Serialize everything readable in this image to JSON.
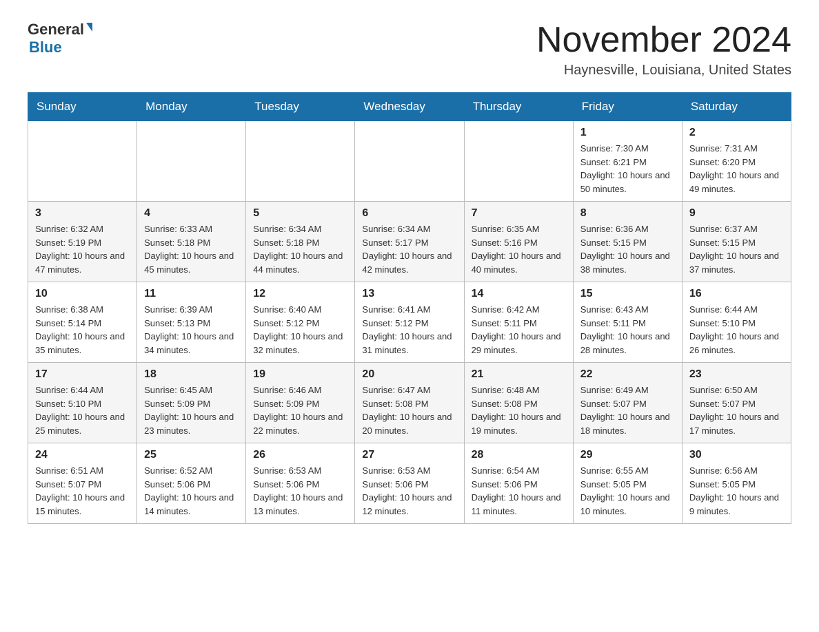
{
  "header": {
    "logo_general": "General",
    "logo_blue": "Blue",
    "title": "November 2024",
    "location": "Haynesville, Louisiana, United States"
  },
  "weekdays": [
    "Sunday",
    "Monday",
    "Tuesday",
    "Wednesday",
    "Thursday",
    "Friday",
    "Saturday"
  ],
  "rows": [
    {
      "cells": [
        {
          "day": "",
          "info": ""
        },
        {
          "day": "",
          "info": ""
        },
        {
          "day": "",
          "info": ""
        },
        {
          "day": "",
          "info": ""
        },
        {
          "day": "",
          "info": ""
        },
        {
          "day": "1",
          "info": "Sunrise: 7:30 AM\nSunset: 6:21 PM\nDaylight: 10 hours and 50 minutes."
        },
        {
          "day": "2",
          "info": "Sunrise: 7:31 AM\nSunset: 6:20 PM\nDaylight: 10 hours and 49 minutes."
        }
      ]
    },
    {
      "cells": [
        {
          "day": "3",
          "info": "Sunrise: 6:32 AM\nSunset: 5:19 PM\nDaylight: 10 hours and 47 minutes."
        },
        {
          "day": "4",
          "info": "Sunrise: 6:33 AM\nSunset: 5:18 PM\nDaylight: 10 hours and 45 minutes."
        },
        {
          "day": "5",
          "info": "Sunrise: 6:34 AM\nSunset: 5:18 PM\nDaylight: 10 hours and 44 minutes."
        },
        {
          "day": "6",
          "info": "Sunrise: 6:34 AM\nSunset: 5:17 PM\nDaylight: 10 hours and 42 minutes."
        },
        {
          "day": "7",
          "info": "Sunrise: 6:35 AM\nSunset: 5:16 PM\nDaylight: 10 hours and 40 minutes."
        },
        {
          "day": "8",
          "info": "Sunrise: 6:36 AM\nSunset: 5:15 PM\nDaylight: 10 hours and 38 minutes."
        },
        {
          "day": "9",
          "info": "Sunrise: 6:37 AM\nSunset: 5:15 PM\nDaylight: 10 hours and 37 minutes."
        }
      ]
    },
    {
      "cells": [
        {
          "day": "10",
          "info": "Sunrise: 6:38 AM\nSunset: 5:14 PM\nDaylight: 10 hours and 35 minutes."
        },
        {
          "day": "11",
          "info": "Sunrise: 6:39 AM\nSunset: 5:13 PM\nDaylight: 10 hours and 34 minutes."
        },
        {
          "day": "12",
          "info": "Sunrise: 6:40 AM\nSunset: 5:12 PM\nDaylight: 10 hours and 32 minutes."
        },
        {
          "day": "13",
          "info": "Sunrise: 6:41 AM\nSunset: 5:12 PM\nDaylight: 10 hours and 31 minutes."
        },
        {
          "day": "14",
          "info": "Sunrise: 6:42 AM\nSunset: 5:11 PM\nDaylight: 10 hours and 29 minutes."
        },
        {
          "day": "15",
          "info": "Sunrise: 6:43 AM\nSunset: 5:11 PM\nDaylight: 10 hours and 28 minutes."
        },
        {
          "day": "16",
          "info": "Sunrise: 6:44 AM\nSunset: 5:10 PM\nDaylight: 10 hours and 26 minutes."
        }
      ]
    },
    {
      "cells": [
        {
          "day": "17",
          "info": "Sunrise: 6:44 AM\nSunset: 5:10 PM\nDaylight: 10 hours and 25 minutes."
        },
        {
          "day": "18",
          "info": "Sunrise: 6:45 AM\nSunset: 5:09 PM\nDaylight: 10 hours and 23 minutes."
        },
        {
          "day": "19",
          "info": "Sunrise: 6:46 AM\nSunset: 5:09 PM\nDaylight: 10 hours and 22 minutes."
        },
        {
          "day": "20",
          "info": "Sunrise: 6:47 AM\nSunset: 5:08 PM\nDaylight: 10 hours and 20 minutes."
        },
        {
          "day": "21",
          "info": "Sunrise: 6:48 AM\nSunset: 5:08 PM\nDaylight: 10 hours and 19 minutes."
        },
        {
          "day": "22",
          "info": "Sunrise: 6:49 AM\nSunset: 5:07 PM\nDaylight: 10 hours and 18 minutes."
        },
        {
          "day": "23",
          "info": "Sunrise: 6:50 AM\nSunset: 5:07 PM\nDaylight: 10 hours and 17 minutes."
        }
      ]
    },
    {
      "cells": [
        {
          "day": "24",
          "info": "Sunrise: 6:51 AM\nSunset: 5:07 PM\nDaylight: 10 hours and 15 minutes."
        },
        {
          "day": "25",
          "info": "Sunrise: 6:52 AM\nSunset: 5:06 PM\nDaylight: 10 hours and 14 minutes."
        },
        {
          "day": "26",
          "info": "Sunrise: 6:53 AM\nSunset: 5:06 PM\nDaylight: 10 hours and 13 minutes."
        },
        {
          "day": "27",
          "info": "Sunrise: 6:53 AM\nSunset: 5:06 PM\nDaylight: 10 hours and 12 minutes."
        },
        {
          "day": "28",
          "info": "Sunrise: 6:54 AM\nSunset: 5:06 PM\nDaylight: 10 hours and 11 minutes."
        },
        {
          "day": "29",
          "info": "Sunrise: 6:55 AM\nSunset: 5:05 PM\nDaylight: 10 hours and 10 minutes."
        },
        {
          "day": "30",
          "info": "Sunrise: 6:56 AM\nSunset: 5:05 PM\nDaylight: 10 hours and 9 minutes."
        }
      ]
    }
  ]
}
